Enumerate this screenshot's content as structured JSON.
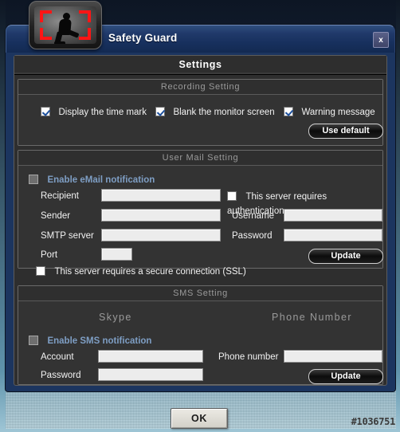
{
  "window": {
    "title": "Safety Guard",
    "close_label": "x",
    "logo_icon": "surveillance-person-icon"
  },
  "panel": {
    "heading": "Settings"
  },
  "recording": {
    "group_title": "Recording Setting",
    "checkboxes": [
      {
        "label": "Display the time mark",
        "checked": true
      },
      {
        "label": "Blank the monitor screen",
        "checked": true
      },
      {
        "label": "Warning message",
        "checked": true
      }
    ],
    "use_default_label": "Use default"
  },
  "mail": {
    "group_title": "User Mail Setting",
    "enable_label": "Enable eMail notification",
    "enable_checked": false,
    "enable_disabled": true,
    "recipient_label": "Recipient",
    "recipient_value": "",
    "sender_label": "Sender",
    "sender_value": "",
    "smtp_label": "SMTP server",
    "smtp_value": "",
    "port_label": "Port",
    "port_value": "",
    "auth_label": "This server requires authentication",
    "auth_checked": false,
    "username_label": "Username",
    "username_value": "",
    "password_label": "Password",
    "password_value": "",
    "ssl_label": "This server requires a secure connection (SSL)",
    "ssl_checked": false,
    "update_label": "Update"
  },
  "sms": {
    "group_title": "SMS Setting",
    "col_skype": "Skype",
    "col_phone": "Phone Number",
    "enable_label": "Enable SMS notification",
    "enable_checked": false,
    "enable_disabled": true,
    "account_label": "Account",
    "account_value": "",
    "password_label": "Password",
    "password_value": "",
    "phone_label": "Phone number",
    "phone_value": "",
    "update_label": "Update"
  },
  "footer": {
    "ok_label": "OK",
    "watermark": "#1036751"
  },
  "colors": {
    "title_bar": "#17305d",
    "panel_bg": "#2e2e2e",
    "group_bg": "#333333",
    "accent_blue_label": "#7e9ec4",
    "check_mark": "#1c4f9c",
    "logo_red": "#ff1515"
  }
}
